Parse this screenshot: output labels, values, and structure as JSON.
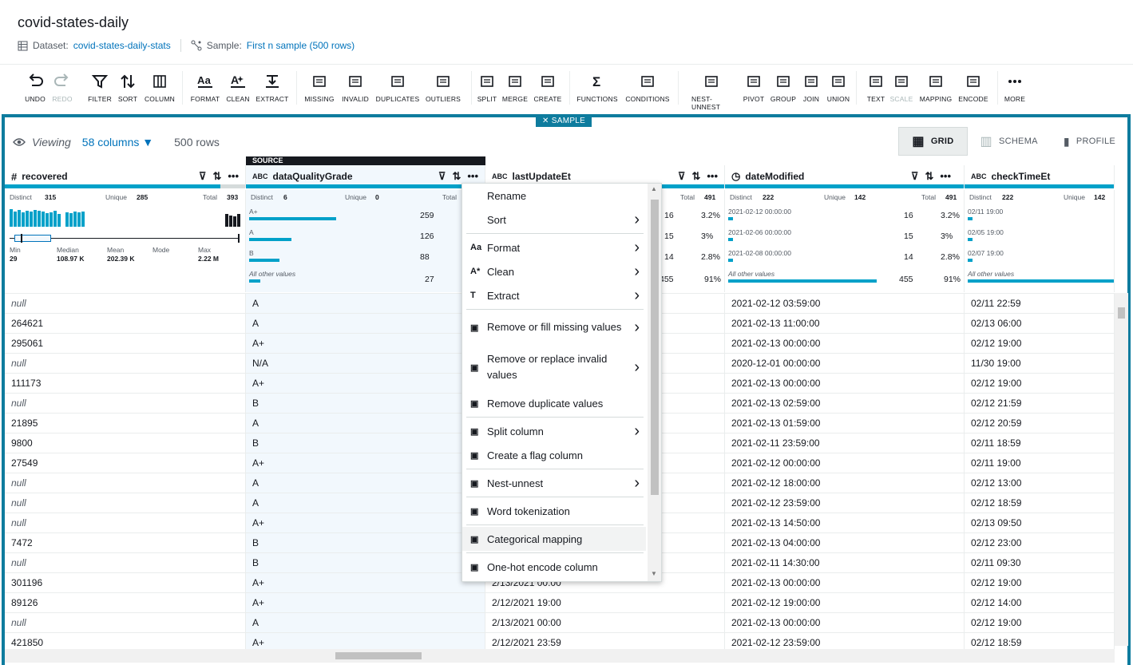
{
  "header": {
    "title": "covid-states-daily",
    "dataset_label": "Dataset:",
    "dataset_value": "covid-states-daily-stats",
    "sample_label": "Sample:",
    "sample_value": "First n sample (500 rows)"
  },
  "toolbar": [
    "UNDO",
    "REDO",
    "FILTER",
    "SORT",
    "COLUMN",
    "FORMAT",
    "CLEAN",
    "EXTRACT",
    "MISSING",
    "INVALID",
    "DUPLICATES",
    "OUTLIERS",
    "SPLIT",
    "MERGE",
    "CREATE",
    "FUNCTIONS",
    "CONDITIONS",
    "NEST-UNNEST",
    "PIVOT",
    "GROUP",
    "JOIN",
    "UNION",
    "TEXT",
    "SCALE",
    "MAPPING",
    "ENCODE",
    "MORE"
  ],
  "sample_badge": "SAMPLE",
  "viewing": {
    "label": "Viewing",
    "columns": "58 columns",
    "rows": "500 rows"
  },
  "view_tabs": [
    "GRID",
    "SCHEMA",
    "PROFILE"
  ],
  "source_label": "SOURCE",
  "columns": [
    {
      "type": "#",
      "name": "recovered"
    },
    {
      "type": "ABC",
      "name": "dataQualityGrade"
    },
    {
      "type": "ABC",
      "name": "lastUpdateEt"
    },
    {
      "type": "clock",
      "name": "dateModified"
    },
    {
      "type": "ABC",
      "name": "checkTimeEt"
    }
  ],
  "stats": {
    "recovered": {
      "distinct_l": "Distinct",
      "distinct": "315",
      "unique_l": "Unique",
      "unique": "285",
      "total_l": "Total",
      "total": "393",
      "min_l": "Min",
      "min": "29",
      "median_l": "Median",
      "median": "108.97 K",
      "mean_l": "Mean",
      "mean": "202.39 K",
      "mode_l": "Mode",
      "max_l": "Max",
      "max": "2.22 M"
    },
    "dataQualityGrade": {
      "distinct_l": "Distinct",
      "distinct": "6",
      "unique_l": "Unique",
      "unique": "0",
      "total_l": "Total",
      "items": [
        {
          "label": "A+",
          "count": "259",
          "frac": 0.52
        },
        {
          "label": "A",
          "count": "126",
          "frac": 0.25
        },
        {
          "label": "B",
          "count": "88",
          "frac": 0.18
        }
      ],
      "other": "All other values",
      "other_count": "27"
    },
    "lastUpdateEt": {
      "total_l": "Total",
      "total": "491",
      "items": [
        {
          "count": "16",
          "pct": "3.2%"
        },
        {
          "count": "15",
          "pct": "3%"
        },
        {
          "count": "14",
          "pct": "2.8%"
        }
      ],
      "other_count": "455",
      "other_pct": "91%"
    },
    "dateModified": {
      "distinct_l": "Distinct",
      "distinct": "222",
      "unique_l": "Unique",
      "unique": "142",
      "total_l": "Total",
      "total": "491",
      "items": [
        {
          "label": "2021-02-12 00:00:00",
          "count": "16",
          "pct": "3.2%"
        },
        {
          "label": "2021-02-06 00:00:00",
          "count": "15",
          "pct": "3%"
        },
        {
          "label": "2021-02-08 00:00:00",
          "count": "14",
          "pct": "2.8%"
        }
      ],
      "other": "All other values",
      "other_count": "455",
      "other_pct": "91%"
    },
    "checkTimeEt": {
      "distinct_l": "Distinct",
      "distinct": "222",
      "unique_l": "Unique",
      "unique": "142",
      "items": [
        {
          "label": "02/11 19:00"
        },
        {
          "label": "02/05 19:00"
        },
        {
          "label": "02/07 19:00"
        }
      ],
      "other": "All other values"
    }
  },
  "rows": [
    [
      "null",
      "A",
      "",
      "2021-02-12 03:59:00",
      "02/11 22:59"
    ],
    [
      "264621",
      "A",
      "",
      "2021-02-13 11:00:00",
      "02/13 06:00"
    ],
    [
      "295061",
      "A+",
      "",
      "2021-02-13 00:00:00",
      "02/12 19:00"
    ],
    [
      "null",
      "N/A",
      "",
      "2020-12-01 00:00:00",
      "11/30 19:00"
    ],
    [
      "111173",
      "A+",
      "",
      "2021-02-13 00:00:00",
      "02/12 19:00"
    ],
    [
      "null",
      "B",
      "",
      "2021-02-13 02:59:00",
      "02/12 21:59"
    ],
    [
      "21895",
      "A",
      "",
      "2021-02-13 01:59:00",
      "02/12 20:59"
    ],
    [
      "9800",
      "B",
      "",
      "2021-02-11 23:59:00",
      "02/11 18:59"
    ],
    [
      "27549",
      "A+",
      "",
      "2021-02-12 00:00:00",
      "02/11 19:00"
    ],
    [
      "null",
      "A",
      "",
      "2021-02-12 18:00:00",
      "02/12 13:00"
    ],
    [
      "null",
      "A",
      "",
      "2021-02-12 23:59:00",
      "02/12 18:59"
    ],
    [
      "null",
      "A+",
      "",
      "2021-02-13 14:50:00",
      "02/13 09:50"
    ],
    [
      "7472",
      "B",
      "",
      "2021-02-13 04:00:00",
      "02/12 23:00"
    ],
    [
      "null",
      "B",
      "",
      "2021-02-11 14:30:00",
      "02/11 09:30"
    ],
    [
      "301196",
      "A+",
      "2/13/2021 00:00",
      "2021-02-13 00:00:00",
      "02/12 19:00"
    ],
    [
      "89126",
      "A+",
      "2/12/2021 19:00",
      "2021-02-12 19:00:00",
      "02/12 14:00"
    ],
    [
      "null",
      "A",
      "2/13/2021 00:00",
      "2021-02-13 00:00:00",
      "02/12 19:00"
    ],
    [
      "421850",
      "A+",
      "2/12/2021 23:59",
      "2021-02-12 23:59:00",
      "02/12 18:59"
    ]
  ],
  "menu": [
    {
      "label": "Rename"
    },
    {
      "label": "Sort",
      "sub": true
    },
    {
      "label": "Format",
      "sub": true,
      "icon": "Aa"
    },
    {
      "label": "Clean",
      "sub": true,
      "icon": "A*"
    },
    {
      "label": "Extract",
      "sub": true,
      "icon": "T"
    },
    {
      "label": "Remove or fill missing values",
      "sub": true,
      "icon": "[]"
    },
    {
      "label": "Remove or replace invalid values",
      "sub": true,
      "icon": "[]"
    },
    {
      "label": "Remove duplicate values",
      "icon": "[]"
    },
    {
      "label": "Split column",
      "sub": true,
      "icon": "[]"
    },
    {
      "label": "Create a flag column",
      "icon": "[]"
    },
    {
      "label": "Nest-unnest",
      "sub": true,
      "icon": "[]"
    },
    {
      "label": "Word tokenization",
      "icon": "[]"
    },
    {
      "label": "Categorical mapping",
      "icon": "[]"
    },
    {
      "label": "One-hot encode column",
      "icon": "[]"
    }
  ]
}
